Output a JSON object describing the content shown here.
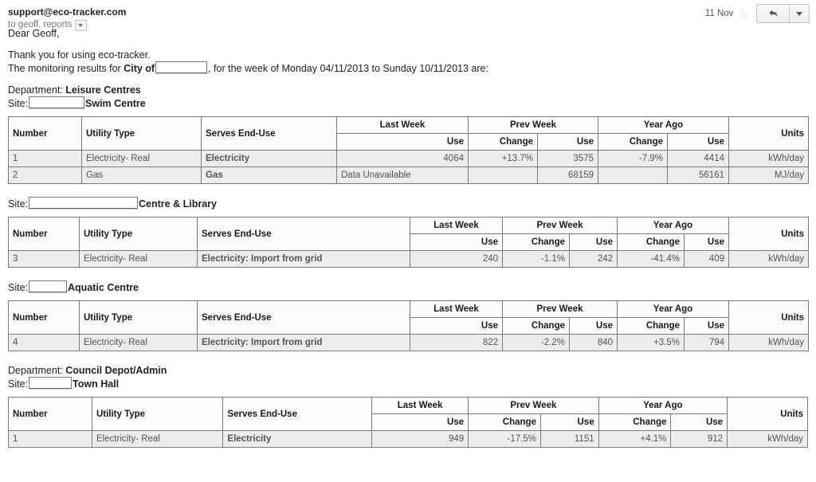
{
  "mail": {
    "sender": "support@eco-tracker.com",
    "recipients": "to geoff, reports",
    "date": "11 Nov",
    "star_icon": "star-icon",
    "reply_icon": "reply-arrow-icon",
    "more_icon": "chevron-down-icon"
  },
  "body": {
    "greeting": "Dear Geoff,",
    "thanks": "Thank you for using eco-tracker.",
    "results_prefix": "The monitoring results for ",
    "city_label": "City of",
    "results_suffix": ", for the week of Monday 04/11/2013 to Sunday 10/11/2013 are:"
  },
  "columns": {
    "number": "Number",
    "utility_type": "Utility Type",
    "serves_end_use": "Serves End-Use",
    "last_week": "Last Week",
    "prev_week": "Prev Week",
    "year_ago": "Year Ago",
    "units": "Units",
    "use": "Use",
    "change": "Change"
  },
  "labels": {
    "department": "Department:",
    "site": "Site:"
  },
  "colors": {
    "positive_change": "#ee3b3b",
    "negative_change": "#5a5ad0",
    "unavailable": "#ee4444",
    "row_background": "#ececec",
    "header_background": "#fbfbfb",
    "border": "#7a7a7a"
  },
  "sections": [
    {
      "department": "Leisure Centres",
      "site_suffix": "Swim Centre",
      "rows": [
        {
          "number": "1",
          "utility_type": "Electricity- Real",
          "serves_end_use": "Electricity",
          "last_week_use": "4064",
          "prev_change": "+13.7%",
          "prev_change_sign": "pos",
          "prev_use": "3575",
          "year_change": "-7.9%",
          "year_change_sign": "neg",
          "year_use": "4414",
          "units": "kWh/day"
        },
        {
          "number": "2",
          "utility_type": "Gas",
          "serves_end_use": "Gas",
          "last_week_use": "Data Unavailable",
          "last_week_unavailable": true,
          "prev_change": "",
          "prev_change_sign": "",
          "prev_use": "68159",
          "year_change": "",
          "year_change_sign": "",
          "year_use": "56161",
          "units": "MJ/day"
        }
      ]
    },
    {
      "department": null,
      "site_suffix": "Centre & Library",
      "rows": [
        {
          "number": "3",
          "utility_type": "Electricity- Real",
          "serves_end_use": "Electricity: Import from grid",
          "last_week_use": "240",
          "prev_change": "-1.1%",
          "prev_change_sign": "neg",
          "prev_use": "242",
          "year_change": "-41.4%",
          "year_change_sign": "neg",
          "year_use": "409",
          "units": "kWh/day"
        }
      ]
    },
    {
      "department": null,
      "site_suffix": "Aquatic Centre",
      "rows": [
        {
          "number": "4",
          "utility_type": "Electricity- Real",
          "serves_end_use": "Electricity: Import from grid",
          "last_week_use": "822",
          "prev_change": "-2.2%",
          "prev_change_sign": "neg",
          "prev_use": "840",
          "year_change": "+3.5%",
          "year_change_sign": "pos",
          "year_use": "794",
          "units": "kWh/day"
        }
      ]
    },
    {
      "department": "Council Depot/Admin",
      "site_suffix": "Town Hall",
      "rows": [
        {
          "number": "1",
          "utility_type": "Electricity- Real",
          "serves_end_use": "Electricity",
          "last_week_use": "949",
          "prev_change": "-17.5%",
          "prev_change_sign": "neg",
          "prev_use": "1151",
          "year_change": "+4.1%",
          "year_change_sign": "pos",
          "year_use": "912",
          "units": "kWh/day"
        }
      ]
    }
  ]
}
